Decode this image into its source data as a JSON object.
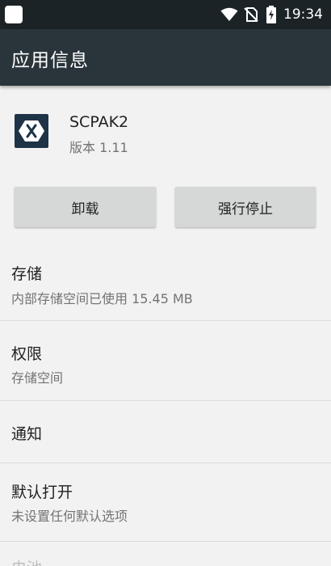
{
  "status_bar": {
    "time": "19:34",
    "icons": [
      "notification-icon",
      "wifi-icon",
      "no-sim-icon",
      "battery-charging-icon"
    ]
  },
  "app_bar": {
    "title": "应用信息"
  },
  "app": {
    "icon": "xamarin-app-icon",
    "name": "SCPAK2",
    "version": "版本 1.11"
  },
  "buttons": {
    "uninstall": "卸载",
    "force_stop": "强行停止"
  },
  "settings": {
    "storage": {
      "title": "存储",
      "subtitle": "内部存储空间已使用 15.45 MB"
    },
    "permissions": {
      "title": "权限",
      "subtitle": "存储空间"
    },
    "notifications": {
      "title": "通知"
    },
    "open_by_default": {
      "title": "默认打开",
      "subtitle": "未设置任何默认选项"
    },
    "battery": {
      "title": "电池"
    }
  },
  "colors": {
    "status_bar": "#1b2326",
    "app_bar": "#2a353b",
    "background": "#f2f2f2",
    "button": "#d6d7d7",
    "app_icon_bg": "#1f3346"
  }
}
